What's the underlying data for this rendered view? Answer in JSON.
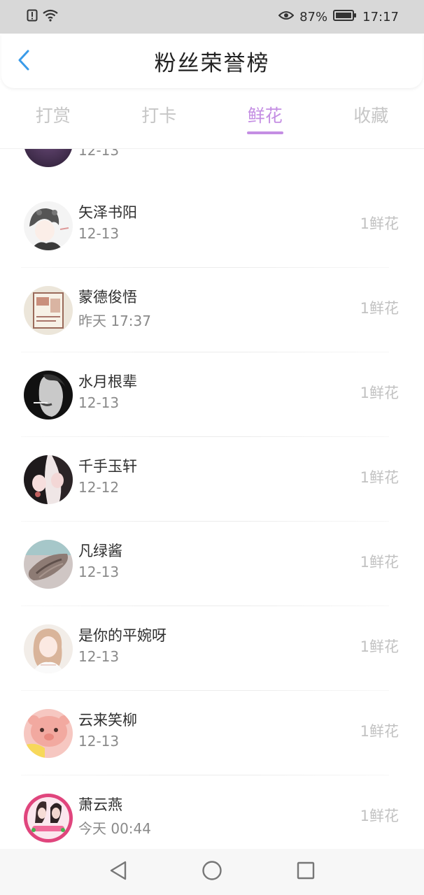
{
  "status_bar": {
    "battery_percent": "87%",
    "time": "17:17",
    "icons": [
      "alert-icon",
      "wifi-icon",
      "eye-icon",
      "battery-icon"
    ]
  },
  "header": {
    "title": "粉丝荣誉榜",
    "back_icon": "chevron-left-icon"
  },
  "tabs": [
    {
      "label": "打赏",
      "active": false
    },
    {
      "label": "打卡",
      "active": false
    },
    {
      "label": "鲜花",
      "active": true
    },
    {
      "label": "收藏",
      "active": false
    }
  ],
  "colors": {
    "accent": "#c48ee3",
    "back": "#3a9be9",
    "muted": "#c2c2c2"
  },
  "list": {
    "partial_top": {
      "date": "12-13"
    },
    "items": [
      {
        "name": "矢泽书阳",
        "date": "12-13",
        "count": "1鲜花"
      },
      {
        "name": "蒙德俊悟",
        "date": "昨天 17:37",
        "count": "1鲜花"
      },
      {
        "name": "水月根辈",
        "date": "12-13",
        "count": "1鲜花"
      },
      {
        "name": "千手玉轩",
        "date": "12-12",
        "count": "1鲜花"
      },
      {
        "name": "凡绿酱",
        "date": "12-13",
        "count": "1鲜花"
      },
      {
        "name": "是你的平婉呀",
        "date": "12-13",
        "count": "1鲜花"
      },
      {
        "name": "云来笑柳",
        "date": "12-13",
        "count": "1鲜花"
      },
      {
        "name": "萧云燕",
        "date": "今天 00:44",
        "count": "1鲜花"
      }
    ]
  },
  "nav": [
    "back-triangle-icon",
    "home-circle-icon",
    "recents-square-icon"
  ]
}
